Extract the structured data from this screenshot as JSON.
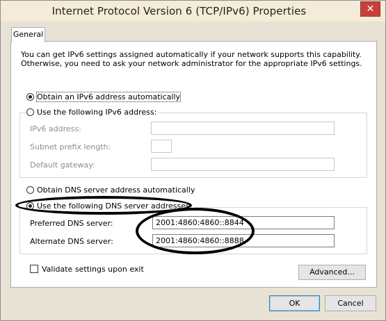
{
  "window": {
    "title": "Internet Protocol Version 6 (TCP/IPv6) Properties",
    "close_glyph": "✕"
  },
  "tabs": [
    {
      "label": "General",
      "selected": true
    }
  ],
  "intro_text": "You can get IPv6 settings assigned automatically if your network supports this capability. Otherwise, you need to ask your network administrator for the appropriate IPv6 settings.",
  "ip_section": {
    "auto_option": {
      "label": "Obtain an IPv6 address automatically",
      "selected": true
    },
    "manual_option": {
      "label": "Use the following IPv6 address:",
      "selected": false
    },
    "fields": [
      {
        "label": "IPv6 address:",
        "value": "",
        "enabled": false
      },
      {
        "label": "Subnet prefix length:",
        "value": "",
        "enabled": false
      },
      {
        "label": "Default gateway:",
        "value": "",
        "enabled": false
      }
    ]
  },
  "dns_section": {
    "auto_option": {
      "label": "Obtain DNS server address automatically",
      "selected": false
    },
    "manual_option": {
      "label": "Use the following DNS server addresses:",
      "selected": true
    },
    "preferred": {
      "label": "Preferred DNS server:",
      "value": "2001:4860:4860::8844"
    },
    "alternate": {
      "label": "Alternate DNS server:",
      "value": "2001:4860:4860::8888"
    }
  },
  "validate_checkbox": {
    "label": "Validate settings upon exit",
    "checked": false
  },
  "buttons": {
    "advanced": "Advanced...",
    "ok": "OK",
    "cancel": "Cancel"
  },
  "colors": {
    "title_bar": "#f4ecd8",
    "close_button": "#c7403a",
    "panel": "#ffffff",
    "annotation": "#000000"
  }
}
